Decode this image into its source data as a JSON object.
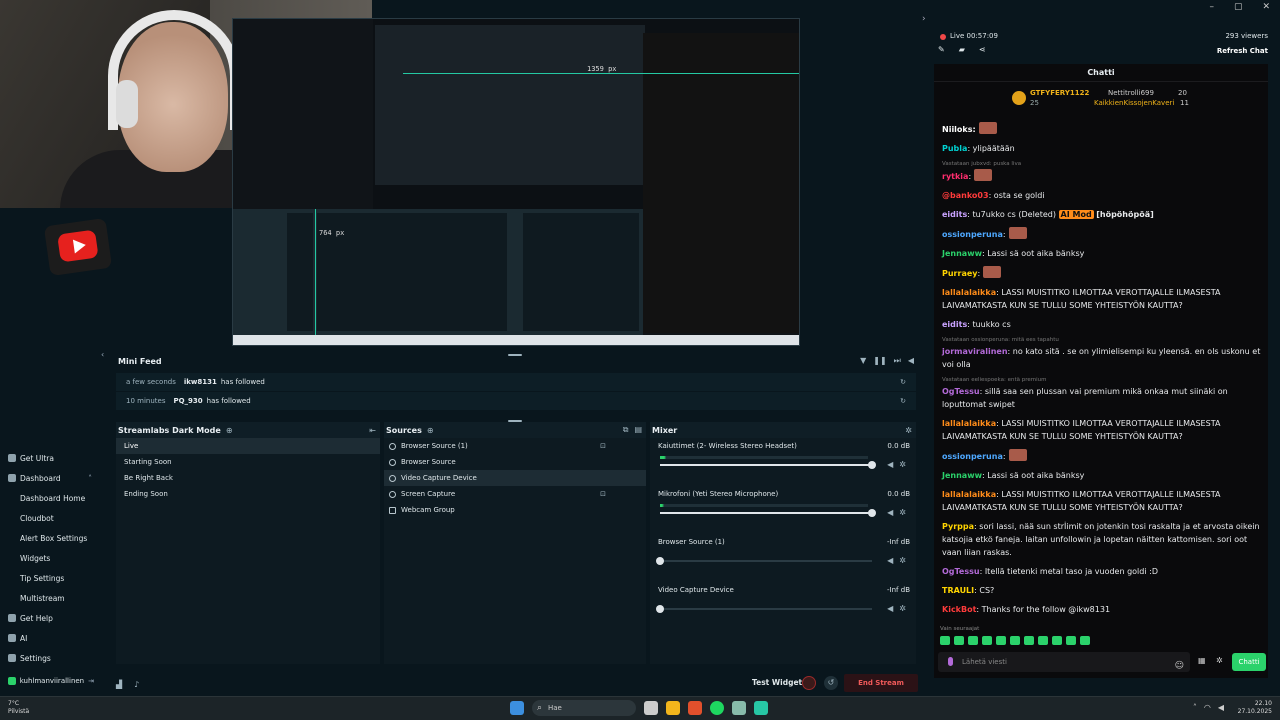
{
  "preview": {
    "measure_top": "1359 px",
    "measure_left": "764 px"
  },
  "minifeed": {
    "title": "Mini Feed",
    "events": [
      {
        "time": "a few seconds",
        "user": "ikw8131",
        "action": "has followed"
      },
      {
        "time": "10 minutes",
        "user": "PQ_930",
        "action": "has followed"
      }
    ]
  },
  "scenes": {
    "title": "Streamlabs Dark Mode",
    "items": [
      "Live",
      "Starting Soon",
      "Be Right Back",
      "Ending Soon"
    ]
  },
  "sources": {
    "title": "Sources",
    "items": [
      "Browser Source (1)",
      "Browser Source",
      "Video Capture Device",
      "Screen Capture",
      "Webcam Group"
    ]
  },
  "mixer": {
    "title": "Mixer",
    "channels": [
      {
        "name": "Kaiuttimet (2- Wireless Stereo Headset)",
        "db": "0.0 dB",
        "level": 1.0
      },
      {
        "name": "Mikrofoni (Yeti Stereo Microphone)",
        "db": "0.0 dB",
        "level": 1.0
      },
      {
        "name": "Browser Source (1)",
        "db": "-Inf dB",
        "level": 0
      },
      {
        "name": "Video Capture Device",
        "db": "-Inf dB",
        "level": 0
      }
    ]
  },
  "sidebar": {
    "items": [
      {
        "label": "Get Ultra",
        "sub": false
      },
      {
        "label": "Dashboard",
        "sub": false
      },
      {
        "label": "Dashboard Home",
        "sub": true
      },
      {
        "label": "Cloudbot",
        "sub": true
      },
      {
        "label": "Alert Box Settings",
        "sub": true
      },
      {
        "label": "Widgets",
        "sub": true
      },
      {
        "label": "Tip Settings",
        "sub": true
      },
      {
        "label": "Multistream",
        "sub": true
      },
      {
        "label": "Get Help",
        "sub": false
      },
      {
        "label": "AI",
        "sub": false
      },
      {
        "label": "Settings",
        "sub": false
      }
    ],
    "user": "kuhlmanviirallinen"
  },
  "bottombar": {
    "test_widgets": "Test Widgets",
    "end_stream": "End Stream"
  },
  "chat_header": {
    "live": "Live 00:57:09",
    "viewers": "293 viewers",
    "refresh": "Refresh Chat",
    "title": "Chatti"
  },
  "leaderboard": {
    "first_name": "GTFYFERY1122",
    "first_sub": "25",
    "second_name": "Nettitrolli699",
    "second_num": "20",
    "third_name": "KaikkienKissojenKaveri",
    "third_num": "11"
  },
  "chat": [
    {
      "reply": "",
      "user": "Niiloks:",
      "color": "#ffffff",
      "text": ""
    },
    {
      "reply": "",
      "user": "Publa",
      "color": "#00d2d2",
      "text": ": ylipäätään"
    },
    {
      "reply": "Vastataan jubxvd: puska liva",
      "user": "rytkia",
      "color": "#ff2d6e",
      "text": ":"
    },
    {
      "reply": "",
      "user": "@banko03",
      "color": "#ff3b3b",
      "text": ": osta se goldi"
    },
    {
      "reply": "",
      "user": "eidits",
      "color": "#c9a2ff",
      "text": ": tu7ukko cs (Deleted)"
    },
    {
      "reply": "",
      "user": "ossionperuna",
      "color": "#4ea8ff",
      "text": ":"
    },
    {
      "reply": "",
      "user": "Jennaww",
      "color": "#2bd26b",
      "text": ": Lassi sä oot aika bänksy"
    },
    {
      "reply": "",
      "user": "Purraey",
      "color": "#ffd400",
      "text": ":"
    },
    {
      "reply": "",
      "user": "lallalalaikka",
      "color": "#ff8c1a",
      "text": ": LASSI MUISTITKO ILMOTTAA VEROTTAJALLE ILMASESTA LAIVAMATKASTA KUN SE TULLU SOME YHTEISTYÖN KAUTTA?"
    },
    {
      "reply": "",
      "user": "eidits",
      "color": "#c9a2ff",
      "text": ": tuukko cs"
    },
    {
      "reply": "Vastataan ossionperuna: mitä ees tapahtu",
      "user": "jormaviralinen",
      "color": "#b36ad8",
      "text": ": no kato sitä . se on ylimielisempi ku yleensä. en ols uskonu et voi olla"
    },
    {
      "reply": "Vastataan eeliespoeka: entä premium",
      "user": "OgTessu",
      "color": "#b36ad8",
      "text": ": sillä saa sen plussan vai premium mikä onkaa mut siinäki on loputtomat swipet"
    },
    {
      "reply": "",
      "user": "lallalalaikka",
      "color": "#ff8c1a",
      "text": ": LASSI MUISTITKO ILMOTTAA VEROTTAJALLE ILMASESTA LAIVAMATKASTA KUN SE TULLU SOME YHTEISTYÖN KAUTTA?"
    },
    {
      "reply": "",
      "user": "ossionperuna",
      "color": "#4ea8ff",
      "text": ":"
    },
    {
      "reply": "",
      "user": "Jennaww",
      "color": "#2bd26b",
      "text": ": Lassi sä oot aika bänksy"
    },
    {
      "reply": "",
      "user": "lallalalaikka",
      "color": "#ff8c1a",
      "text": ": LASSI MUISTITKO ILMOTTAA VEROTTAJALLE ILMASESTA LAIVAMATKASTA KUN SE TULLU SOME YHTEISTYÖN KAUTTA?"
    },
    {
      "reply": "",
      "user": "Pyrppa",
      "color": "#ffd400",
      "text": ": sori lassi, nää sun strİimit on jotenkin tosi raskalta ja et arvosta oikein katsojia etkö faneja. laitan unfollowin ja lopetan näitten kattomisen. sori oot vaan liian raskas."
    },
    {
      "reply": "",
      "user": "OgTessu",
      "color": "#b36ad8",
      "text": ": Itellä tietenki metal taso ja vuoden goldi :D"
    },
    {
      "reply": "",
      "user": "TRAULI",
      "color": "#ffd400",
      "text": ": CS?"
    },
    {
      "reply": "",
      "user": "KickBot",
      "color": "#ff3b3b",
      "text": ": Thanks for the follow @ikw8131"
    }
  ],
  "chat_extra": {
    "mod_badge": "AI Mod",
    "mod_tail": "[höpöhöpöä]"
  },
  "chat_input": {
    "only_followers": "Vain seuraajat",
    "placeholder": "Lähetä viesti",
    "send": "Chatti"
  },
  "taskbar": {
    "weather_temp": "7°C",
    "weather_desc": "Pilvistä",
    "search": "Hae",
    "time": "22.10",
    "date": "27.10.2025"
  }
}
